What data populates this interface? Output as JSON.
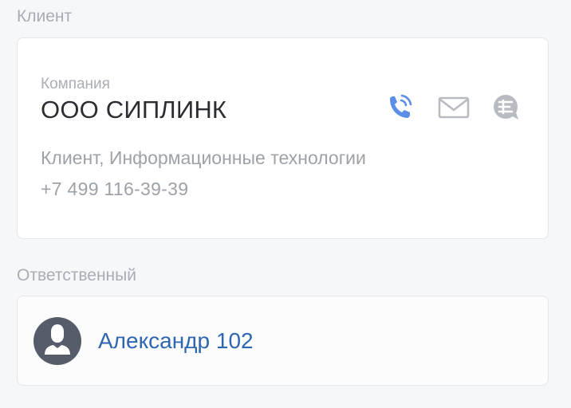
{
  "client_section": {
    "label": "Клиент",
    "company_caption": "Компания",
    "company_name": "ООО СИПЛИНК",
    "tags": "Клиент, Информационные технологии",
    "phone": "+7 499 116-39-39",
    "actions": [
      {
        "icon": "phone-call-icon",
        "color": "#5b8ee6"
      },
      {
        "icon": "envelope-icon",
        "color": "#b8bcc2"
      },
      {
        "icon": "chat-bubble-icon",
        "color": "#b8bcc2"
      }
    ]
  },
  "responsible_section": {
    "label": "Ответственный",
    "person_name": "Александр 102",
    "avatar_icon": "user-silhouette-icon",
    "avatar_color": "#565d6a",
    "link_color": "#2f66b1"
  }
}
